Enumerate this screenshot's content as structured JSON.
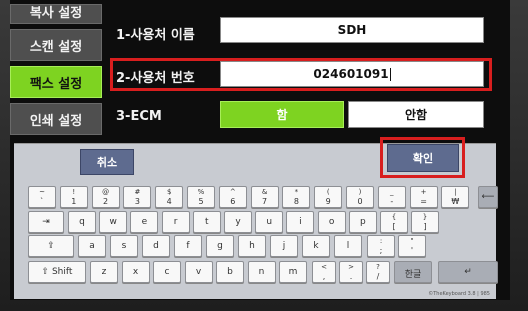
{
  "sidebar": {
    "items": [
      {
        "label": "복사 설정",
        "active": false
      },
      {
        "label": "스캔 설정",
        "active": false
      },
      {
        "label": "팩스 설정",
        "active": true
      },
      {
        "label": "인쇄 설정",
        "active": false
      }
    ]
  },
  "form": {
    "user_name_label": "1-사용처 이름",
    "user_name_value": "SDH",
    "user_number_label": "2-사용처 번호",
    "user_number_value": "024601091",
    "ecm_label": "3-ECM",
    "ecm_on": "함",
    "ecm_off": "안함"
  },
  "keyboard": {
    "cancel_label": "취소",
    "confirm_label": "확인",
    "row1": [
      [
        "~",
        "`"
      ],
      [
        "!",
        "1"
      ],
      [
        "@",
        "2"
      ],
      [
        "#",
        "3"
      ],
      [
        "$",
        "4"
      ],
      [
        "%",
        "5"
      ],
      [
        "^",
        "6"
      ],
      [
        "&",
        "7"
      ],
      [
        "*",
        "8"
      ],
      [
        "(",
        "9"
      ],
      [
        ")",
        "0"
      ],
      [
        "_",
        "-"
      ],
      [
        "+",
        "="
      ],
      [
        "|",
        "₩"
      ]
    ],
    "row2": [
      "q",
      "w",
      "e",
      "r",
      "t",
      "y",
      "u",
      "i",
      "o",
      "p"
    ],
    "row2_brackets": [
      [
        "{",
        "["
      ],
      [
        "}",
        "]"
      ]
    ],
    "row3": [
      "a",
      "s",
      "d",
      "f",
      "g",
      "h",
      "j",
      "k",
      "l"
    ],
    "row3_punct": [
      [
        ":",
        ";"
      ],
      [
        "\"",
        "'"
      ]
    ],
    "row4": [
      "z",
      "x",
      "c",
      "v",
      "b",
      "n",
      "m"
    ],
    "row4_punct": [
      [
        "<",
        ","
      ],
      [
        ">",
        "."
      ],
      [
        "?",
        "/"
      ]
    ],
    "tab_label": "⇥",
    "caps_label": "⇪",
    "shift_label": "Shift",
    "shift_icon": "⇧",
    "backspace_label": "⟵",
    "enter_label": "↵",
    "hangul_label": "한글",
    "version": "©TheKeyboard 3.8 | 985"
  }
}
